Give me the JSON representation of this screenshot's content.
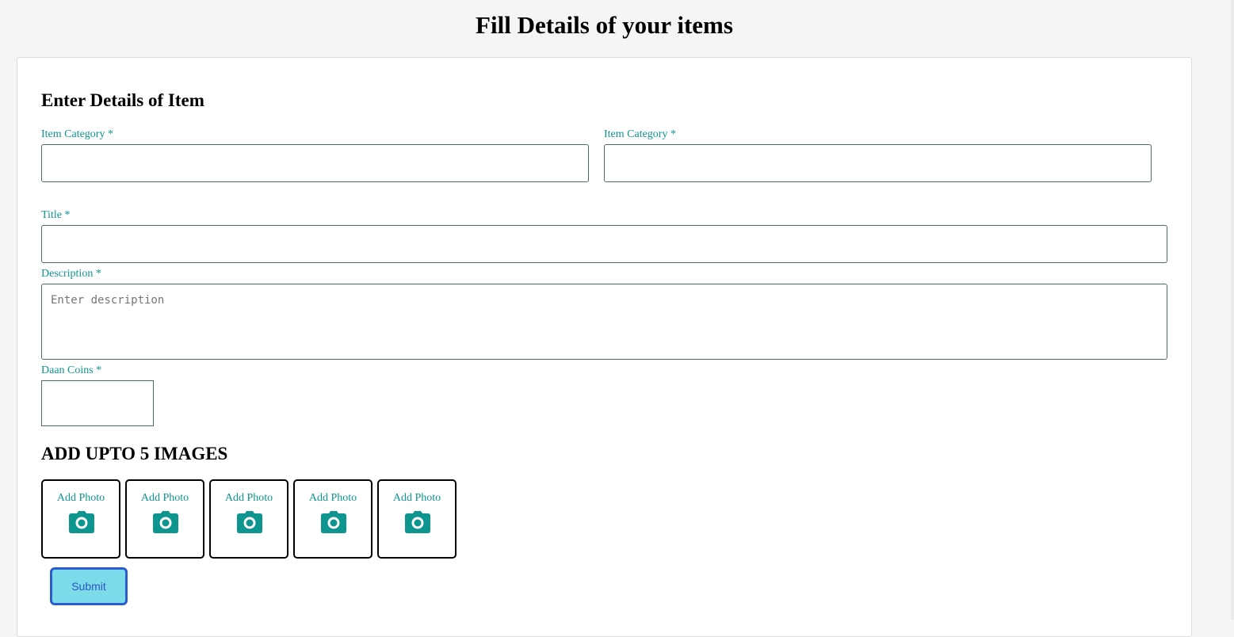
{
  "page": {
    "title": "Fill Details of your items"
  },
  "form": {
    "section_title": "Enter Details of Item",
    "category_left": {
      "label": "Item Category *",
      "value": ""
    },
    "category_right": {
      "label": "Item Category *",
      "value": ""
    },
    "title_field": {
      "label": "Title *",
      "value": ""
    },
    "description": {
      "label": "Description *",
      "placeholder": "Enter description",
      "value": ""
    },
    "coins": {
      "label": "Daan Coins *",
      "value": ""
    }
  },
  "images": {
    "title": "ADD UPTO 5 IMAGES",
    "slots": [
      {
        "label": "Add Photo",
        "icon": "camera-icon"
      },
      {
        "label": "Add Photo",
        "icon": "camera-icon"
      },
      {
        "label": "Add Photo",
        "icon": "camera-icon"
      },
      {
        "label": "Add Photo",
        "icon": "camera-icon"
      },
      {
        "label": "Add Photo",
        "icon": "camera-icon"
      }
    ]
  },
  "actions": {
    "submit_label": "Submit"
  },
  "colors": {
    "accent": "#0e9590",
    "submit_bg": "#7bdbe8",
    "submit_border": "#2a5bd0"
  }
}
